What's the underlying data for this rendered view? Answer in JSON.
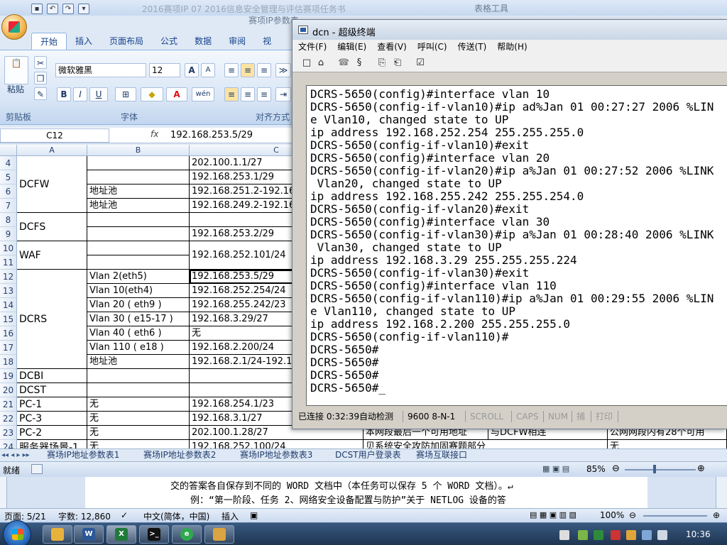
{
  "excel": {
    "title_left": "2016赛项IP 07 2016信息安全管理与评估赛项任务书",
    "title_doc": "赛项IP参数表",
    "contextual_tab": "表格工具",
    "view_tab_partial": "视",
    "tabs": [
      "开始",
      "插入",
      "页面布局",
      "公式",
      "数据",
      "审阅"
    ],
    "paste_label": "粘贴",
    "font_name": "微软雅黑",
    "font_size": "12",
    "groups": {
      "clipboard": "剪贴板",
      "font": "字体",
      "alignment": "对齐方式"
    },
    "formula_bar": {
      "name_box": "C12",
      "fx": "fx",
      "value": "192.168.253.5/29"
    },
    "columns": [
      "A",
      "B",
      "C"
    ],
    "rows": [
      {
        "n": "4",
        "b": "",
        "c": "202.100.1.1/27"
      },
      {
        "n": "5",
        "b": "",
        "c": "192.168.253.1/29"
      },
      {
        "n": "6",
        "b": "地址池",
        "c": "192.168.251.2-192.168"
      },
      {
        "n": "7",
        "b": "地址池",
        "c": "192.168.249.2-192.168"
      },
      {
        "n": "8",
        "b": "",
        "c": ""
      },
      {
        "n": "9",
        "b": "",
        "c": "192.168.253.2/29"
      },
      {
        "n": "10",
        "b": "",
        "c": ""
      },
      {
        "n": "11",
        "b": "",
        "c": ""
      },
      {
        "n": "12",
        "b": "Vlan 2(eth5)",
        "c": "192.168.253.5/29"
      },
      {
        "n": "13",
        "b": "Vlan 10(eth4)",
        "c": "192.168.252.254/24"
      },
      {
        "n": "14",
        "b": "Vlan 20 ( eth9 )",
        "c": "192.168.255.242/23"
      },
      {
        "n": "15",
        "b": "Vlan 30 ( e15-17 )",
        "c": "192.168.3.29/27"
      },
      {
        "n": "16",
        "b": "Vlan 40 ( eth6 )",
        "c": "无"
      },
      {
        "n": "17",
        "b": "Vlan 110 ( e18 )",
        "c": "192.168.2.200/24"
      },
      {
        "n": "18",
        "b": "地址池",
        "c": "192.168.2.1/24-192.168"
      },
      {
        "n": "19",
        "b": "",
        "c": ""
      },
      {
        "n": "20",
        "b": "",
        "c": ""
      },
      {
        "n": "21",
        "b": "无",
        "c": "192.168.254.1/23"
      },
      {
        "n": "22",
        "b": "无",
        "c": "192.168.3.1/27"
      },
      {
        "n": "23",
        "b": "无",
        "c": "202.100.1.28/27"
      },
      {
        "n": "24",
        "b": "无",
        "c": "192.168.252.100/24"
      }
    ],
    "merged_a": [
      {
        "label": "DCFW"
      },
      {
        "label": "DCFS"
      },
      {
        "label": "WAF"
      },
      {
        "label": "DCRS"
      },
      {
        "label": "DCBI"
      },
      {
        "label": "DCST"
      },
      {
        "label": "PC-1"
      },
      {
        "label": "PC-3"
      },
      {
        "label": "PC-2"
      },
      {
        "label": "服务器场景-1"
      }
    ],
    "merged_c": {
      "waf": "192.168.252.101/24"
    },
    "row23_extra": {
      "d": "本网段最后一个可用地址",
      "e": "与DCFW相连",
      "f": "公网网段内有28个可用"
    },
    "row24_extra": {
      "d": "贝系统安全攻防加固赛题部分",
      "f": "无"
    },
    "sheet_tabs": [
      "赛场IP地址参数表1",
      "赛场IP地址参数表2",
      "赛场IP地址参数表3",
      "DCST用户登录表",
      "赛场互联接口"
    ],
    "status": {
      "ready": "就绪",
      "zoom": "85%"
    }
  },
  "word": {
    "line1": "交的答案各自保存到不同的 WORD 文档中（本任务可以保存 5 个 WORD 文档）。↵",
    "line2": "例：“第一阶段、任务 2、网络安全设备配置与防护”关于 NETLOG 设备的答",
    "status": {
      "page": "页面: 5/21",
      "words": "字数: 12,860",
      "lang": "中文(简体，中国)",
      "mode": "插入",
      "zoom": "100%"
    }
  },
  "terminal": {
    "title": "dcn - 超级终端",
    "menu": [
      "文件(F)",
      "编辑(E)",
      "查看(V)",
      "呼叫(C)",
      "传送(T)",
      "帮助(H)"
    ],
    "lines": [
      "DCRS-5650(config)#interface vlan 10",
      "DCRS-5650(config-if-vlan10)#ip ad%Jan 01 00:27:27 2006 %LIN",
      "e Vlan10, changed state to UP",
      "ip address 192.168.252.254 255.255.255.0",
      "DCRS-5650(config-if-vlan10)#exit",
      "DCRS-5650(config)#interface vlan 20",
      "DCRS-5650(config-if-vlan20)#ip a%Jan 01 00:27:52 2006 %LINK",
      " Vlan20, changed state to UP",
      "ip address 192.168.255.242 255.255.254.0",
      "DCRS-5650(config-if-vlan20)#exit",
      "DCRS-5650(config)#interface vlan 30",
      "DCRS-5650(config-if-vlan30)#ip a%Jan 01 00:28:40 2006 %LINK",
      " Vlan30, changed state to UP",
      "ip address 192.168.3.29 255.255.255.224",
      "DCRS-5650(config-if-vlan30)#exit",
      "DCRS-5650(config)#interface vlan 110",
      "DCRS-5650(config-if-vlan110)#ip a%Jan 01 00:29:55 2006 %LIN",
      "e Vlan110, changed state to UP",
      "ip address 192.168.2.200 255.255.255.0",
      "DCRS-5650(config-if-vlan110)#",
      "DCRS-5650#",
      "DCRS-5650#",
      "DCRS-5650#",
      "DCRS-5650#_"
    ],
    "status": {
      "connected": "已连接 0:32:39",
      "detect": "自动检测",
      "baud": "9600 8-N-1",
      "scroll": "SCROLL",
      "caps": "CAPS",
      "num": "NUM",
      "capture": "捕",
      "print": "打印"
    }
  },
  "taskbar": {
    "clock": "10:36"
  }
}
